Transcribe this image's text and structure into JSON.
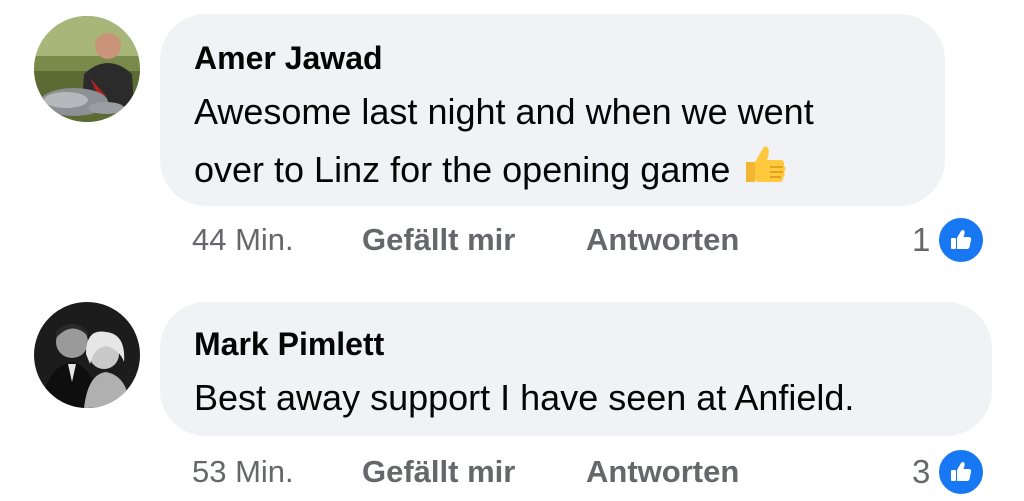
{
  "comments": [
    {
      "author": "Amer Jawad",
      "text_line1": "Awesome last night and when we went",
      "text_line2": "over to Linz for the opening game",
      "emoji": "thumbs-up-emoji",
      "time": "44 Min.",
      "like_label": "Gefällt mir",
      "reply_label": "Antworten",
      "reaction_count": "1",
      "reaction_icon": "like-icon"
    },
    {
      "author": "Mark Pimlett",
      "text_line1": "Best away support I have seen at Anfield.",
      "time": "53 Min.",
      "like_label": "Gefällt mir",
      "reply_label": "Antworten",
      "reaction_count": "3",
      "reaction_icon": "like-icon"
    }
  ],
  "colors": {
    "bubble_bg": "#f0f2f5",
    "meta_text": "#65676b",
    "main_text": "#050505",
    "like_blue": "#1877f2"
  }
}
